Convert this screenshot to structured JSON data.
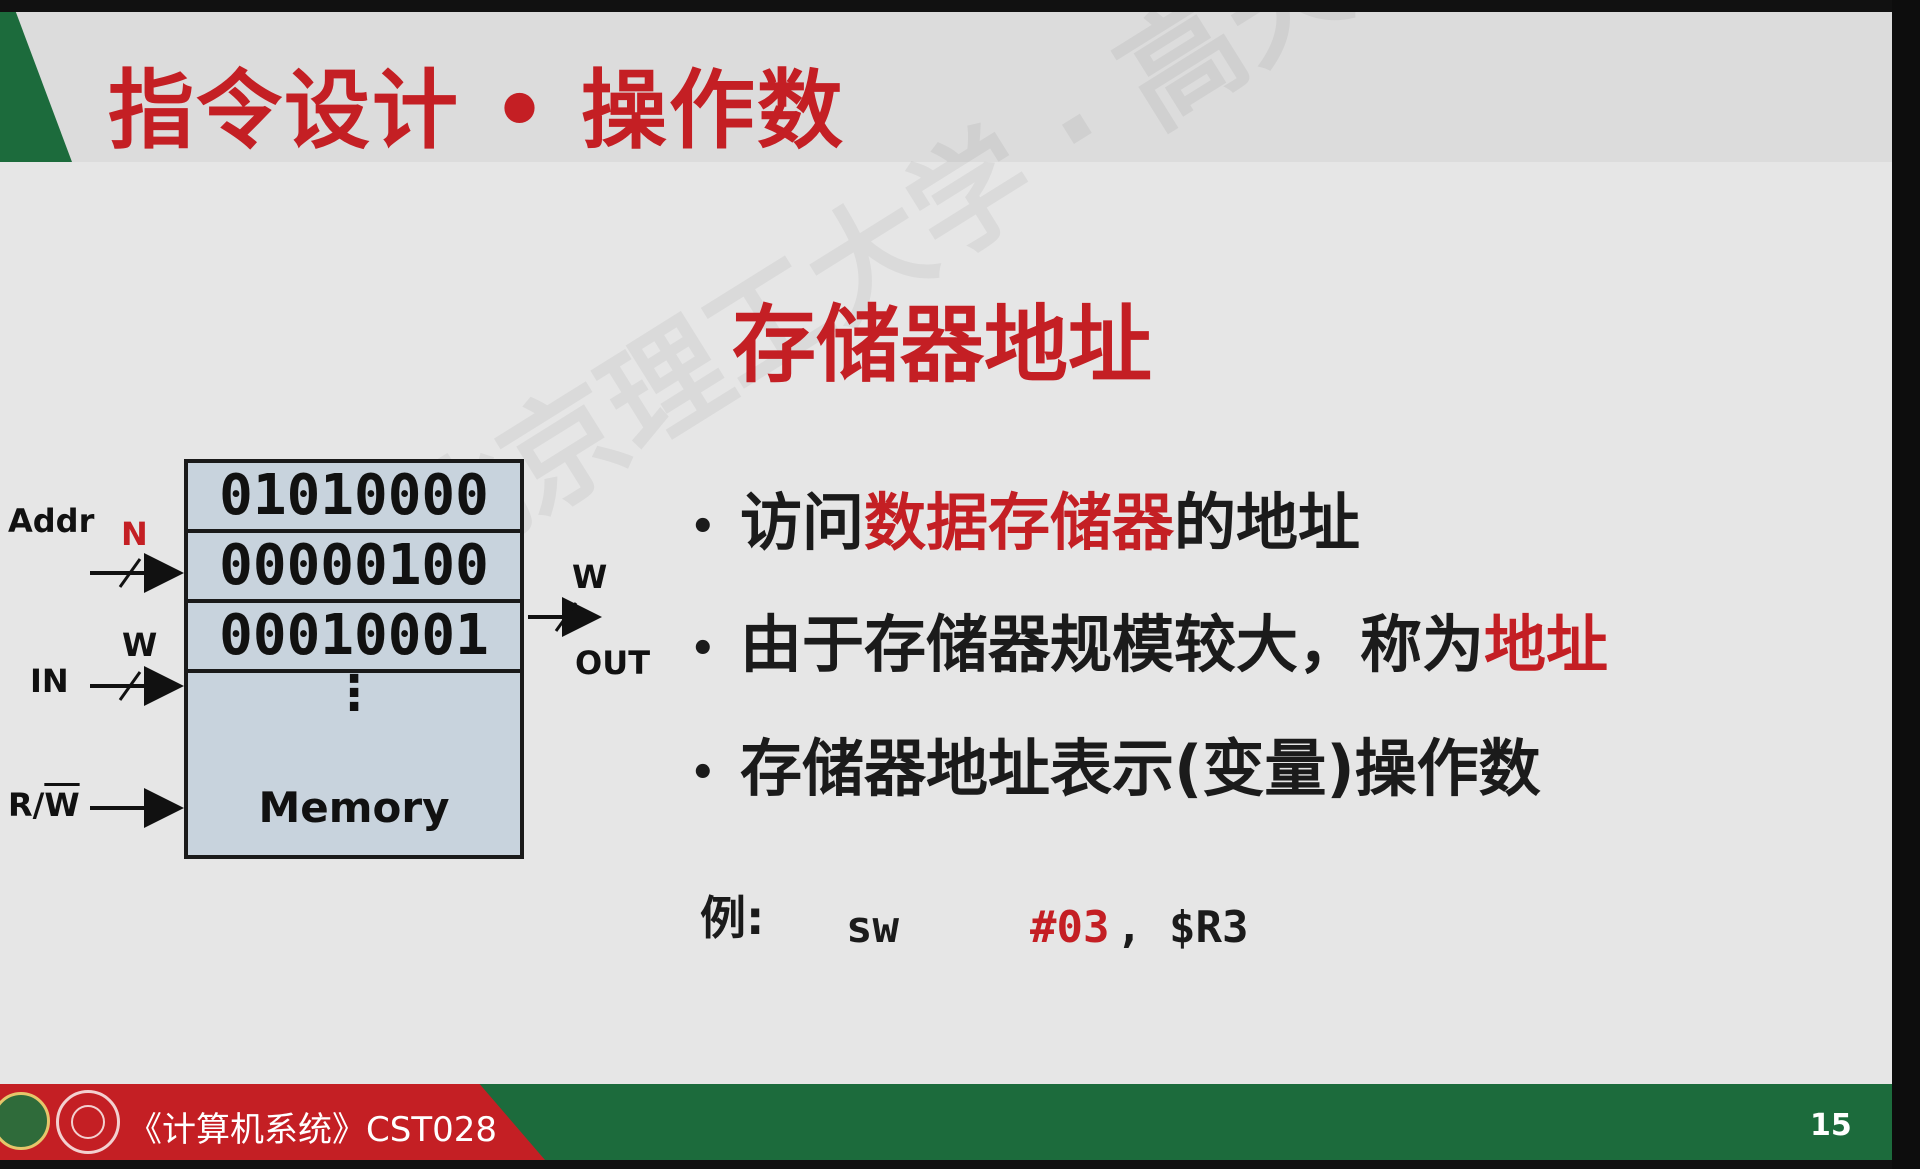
{
  "slide": {
    "title": "指令设计 • 操作数",
    "subtitle": "存储器地址",
    "watermark": "北京理工大学 · 高天"
  },
  "bullets": [
    {
      "segments": [
        {
          "text": "访问",
          "red": false
        },
        {
          "text": "数据存储器",
          "red": true
        },
        {
          "text": "的地址",
          "red": false
        }
      ]
    },
    {
      "segments": [
        {
          "text": "由于存储器规模较大，称为",
          "red": false
        },
        {
          "text": "地址",
          "red": true
        }
      ]
    },
    {
      "segments": [
        {
          "text": "存储器地址表示(变量)操作数",
          "red": false
        }
      ]
    }
  ],
  "bullet_symbol": "•",
  "example": {
    "label": "例:",
    "op": "sw",
    "imm": "#03",
    "reg": ", $R3"
  },
  "diagram": {
    "rows": [
      "01010000",
      "00000100",
      "00010001"
    ],
    "dots": "⋮",
    "label": "Memory",
    "pins": {
      "addr": "Addr",
      "n": "N",
      "in": "IN",
      "w_in": "W",
      "rw_r": "R/",
      "rw_w": "W",
      "w_out": "W",
      "out": "OUT"
    }
  },
  "footer": {
    "course": "《计算机系统》CST028",
    "page": "15"
  },
  "colors": {
    "accent_red": "#c41f24",
    "green": "#1c6b3c"
  }
}
